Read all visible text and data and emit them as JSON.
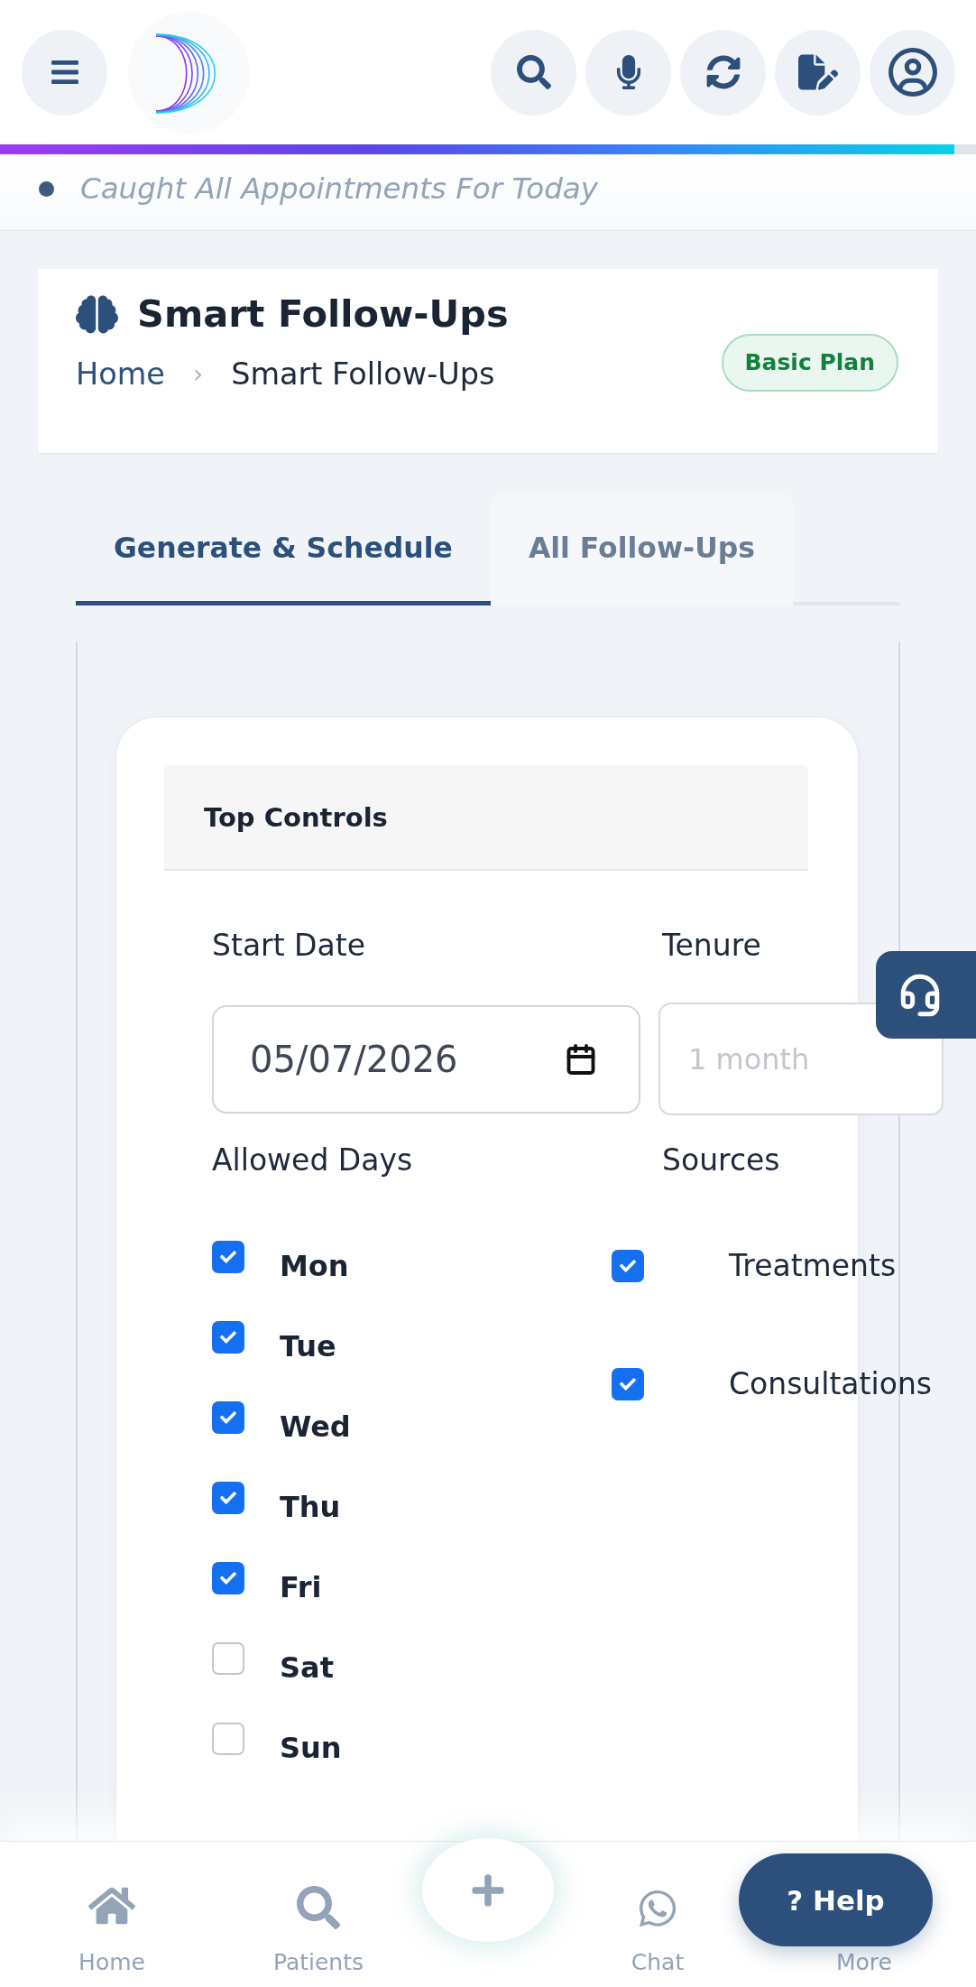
{
  "ticker": {
    "text": "Caught All Appointments For Today"
  },
  "page_header": {
    "title": "Smart Follow-Ups",
    "breadcrumb": [
      {
        "label": "Home",
        "kind": "link"
      },
      {
        "label": "Smart Follow-Ups",
        "kind": "current"
      }
    ],
    "separator": "›",
    "plan_badge": "Basic Plan"
  },
  "tabs": [
    {
      "label": "Generate & Schedule",
      "selected": true
    },
    {
      "label": "All Follow-Ups",
      "selected": false
    }
  ],
  "top_controls": {
    "title": "Top Controls",
    "start_date": {
      "label": "Start Date",
      "value": "05/07/2026"
    },
    "tenure": {
      "label": "Tenure",
      "placeholder": "1 month"
    },
    "allowed_days": {
      "label": "Allowed Days",
      "options": [
        {
          "label": "Mon",
          "checked": true
        },
        {
          "label": "Tue",
          "checked": true
        },
        {
          "label": "Wed",
          "checked": true
        },
        {
          "label": "Thu",
          "checked": true
        },
        {
          "label": "Fri",
          "checked": true
        },
        {
          "label": "Sat",
          "checked": false
        },
        {
          "label": "Sun",
          "checked": false
        }
      ]
    },
    "sources": {
      "label": "Sources",
      "options": [
        {
          "label": "Treatments",
          "checked": true
        },
        {
          "label": "Consultations",
          "checked": true
        }
      ]
    }
  },
  "bottom_nav": {
    "items": [
      {
        "label": "Home",
        "selected": false
      },
      {
        "label": "Patients",
        "selected": false
      },
      {
        "label": "Chat",
        "selected": false
      },
      {
        "label": "More",
        "selected": false
      }
    ]
  },
  "help_button": {
    "label": "? Help"
  }
}
